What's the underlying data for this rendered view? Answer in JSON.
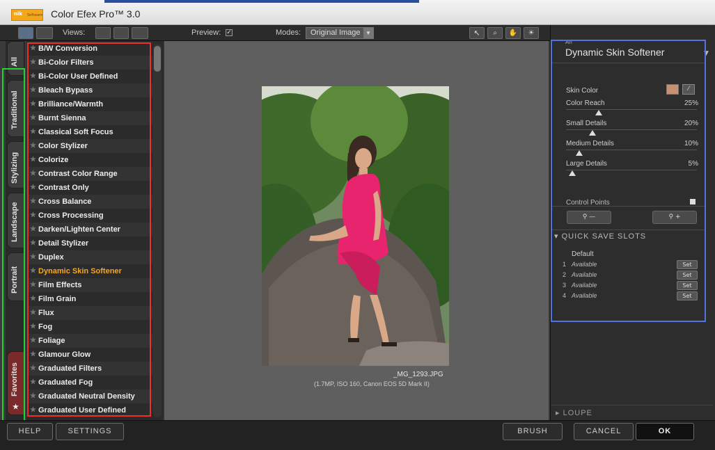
{
  "window": {
    "title": "Color Efex Pro™ 3.0",
    "logo_text": "nik",
    "logo_sub": "Software"
  },
  "toolbar": {
    "views_label": "Views:",
    "preview_label": "Preview:",
    "preview_checked": "✓",
    "modes_label": "Modes:",
    "mode_value": "Original Image"
  },
  "tabs": [
    "All",
    "Traditional",
    "Stylizing",
    "Landscape",
    "Portrait",
    "Favorites"
  ],
  "filters": [
    "B/W Conversion",
    "Bi-Color Filters",
    "Bi-Color User Defined",
    "Bleach Bypass",
    "Brilliance/Warmth",
    "Burnt Sienna",
    "Classical Soft Focus",
    "Color Stylizer",
    "Colorize",
    "Contrast Color Range",
    "Contrast Only",
    "Cross Balance",
    "Cross Processing",
    "Darken/Lighten Center",
    "Detail Stylizer",
    "Duplex",
    "Dynamic Skin Softener",
    "Film Effects",
    "Film Grain",
    "Flux",
    "Fog",
    "Foliage",
    "Glamour Glow",
    "Graduated Filters",
    "Graduated Fog",
    "Graduated Neutral Density",
    "Graduated User Defined"
  ],
  "active_filter": "Dynamic Skin Softener",
  "preview": {
    "filename": "_MG_1293.JPG",
    "meta": "(1.7MP, ISO 160, Canon EOS 5D Mark II)"
  },
  "panel": {
    "tag": "All",
    "title": "Dynamic Skin Softener",
    "skin_color_label": "Skin Color",
    "skin_color": "#c69072",
    "params": [
      {
        "label": "Color Reach",
        "value": "25%",
        "level": 25
      },
      {
        "label": "Small Details",
        "value": "20%",
        "level": 20
      },
      {
        "label": "Medium Details",
        "value": "10%",
        "level": 10
      },
      {
        "label": "Large Details",
        "value": "5%",
        "level": 5
      }
    ],
    "control_points_label": "Control Points"
  },
  "quick_save": {
    "title": "QUICK SAVE SLOTS",
    "default_label": "Default",
    "slots": [
      {
        "num": "1",
        "state": "Available",
        "set": "Set"
      },
      {
        "num": "2",
        "state": "Available",
        "set": "Set"
      },
      {
        "num": "3",
        "state": "Available",
        "set": "Set"
      },
      {
        "num": "4",
        "state": "Available",
        "set": "Set"
      }
    ]
  },
  "loupe_label": "LOUPE",
  "bottom": {
    "help": "HELP",
    "settings": "SETTINGS",
    "brush": "BRUSH",
    "cancel": "CANCEL",
    "ok": "OK"
  }
}
